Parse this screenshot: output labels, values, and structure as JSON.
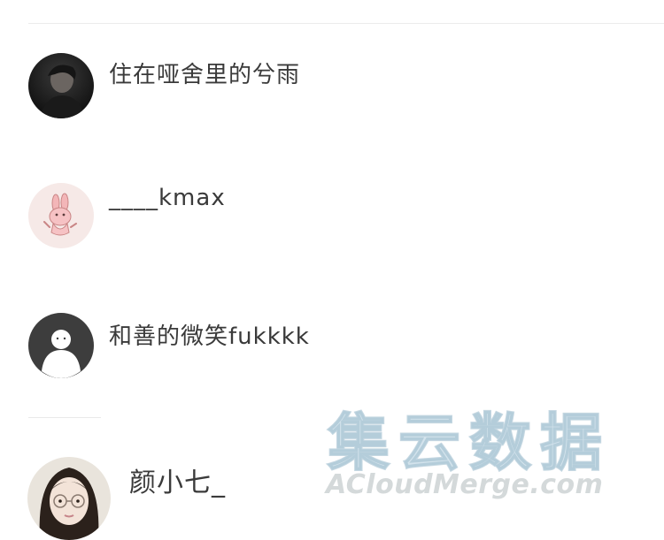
{
  "users": [
    {
      "name": "住在哑舍里的兮雨",
      "avatar_icon": "dark-portrait-avatar"
    },
    {
      "name": "____kmax",
      "avatar_icon": "pink-rabbit-avatar"
    },
    {
      "name": "和善的微笑fukkkk",
      "avatar_icon": "default-user-avatar"
    },
    {
      "name": "颜小七_",
      "avatar_icon": "girl-with-glasses-avatar"
    }
  ],
  "watermark": {
    "main": "集云数据",
    "sub": "ACloudMerge.com"
  }
}
